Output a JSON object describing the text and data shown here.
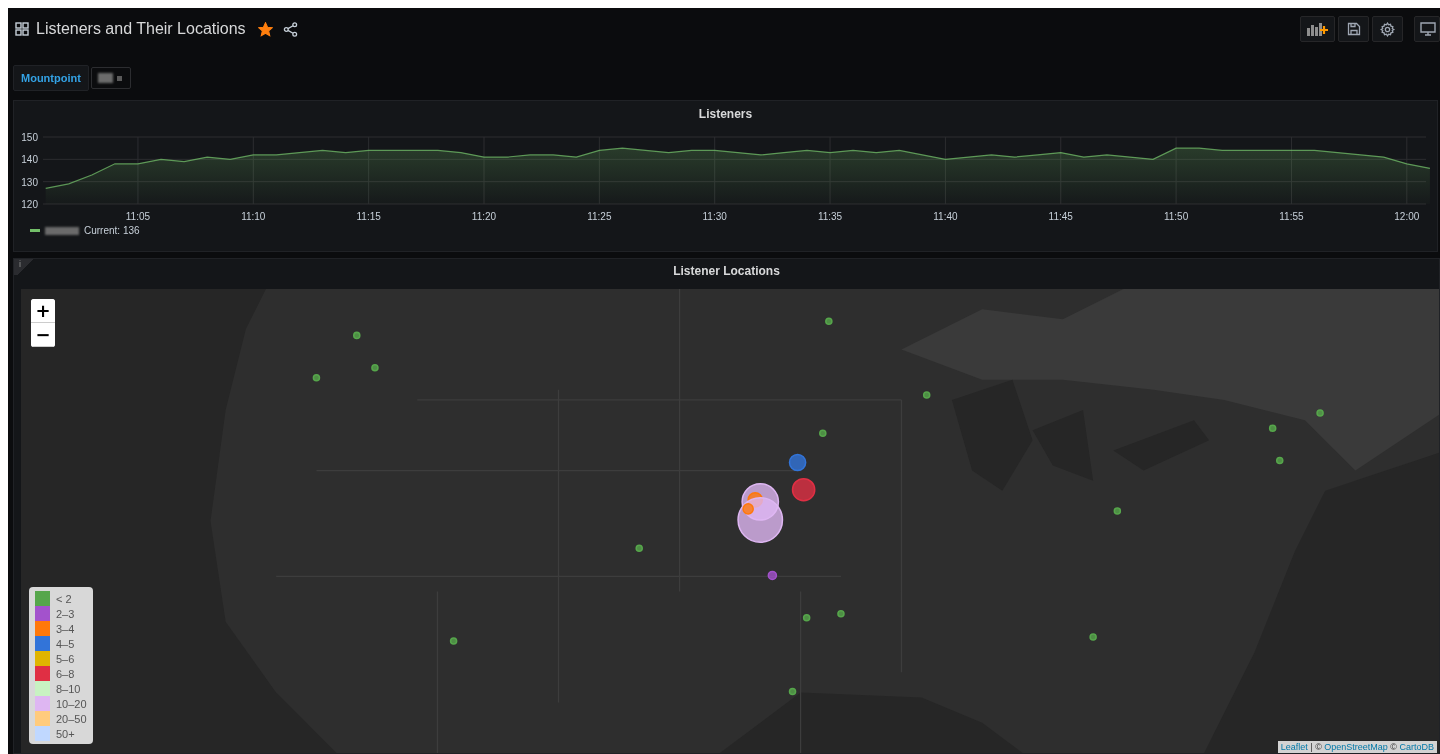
{
  "header": {
    "title": "Listeners and Their Locations",
    "starred": true
  },
  "variables": [
    {
      "label": "Mountpoint"
    }
  ],
  "graph_panel": {
    "title": "Listeners",
    "legend": {
      "current": "Current: 136"
    },
    "chart_data": {
      "type": "area",
      "categories": [
        null,
        null,
        null,
        null,
        "11:05",
        null,
        null,
        null,
        null,
        "11:10",
        null,
        null,
        null,
        null,
        "11:15",
        null,
        null,
        null,
        null,
        "11:20",
        null,
        null,
        null,
        null,
        "11:25",
        null,
        null,
        null,
        null,
        "11:30",
        null,
        null,
        null,
        null,
        "11:35",
        null,
        null,
        null,
        null,
        "11:40",
        null,
        null,
        null,
        null,
        "11:45",
        null,
        null,
        null,
        null,
        "11:50",
        null,
        null,
        null,
        null,
        "11:55",
        null,
        null,
        null,
        null,
        "12:00",
        null
      ],
      "series": [
        {
          "color": "#73bf69",
          "values": [
            127,
            129,
            133,
            138,
            138,
            140,
            139,
            141,
            140,
            142,
            142,
            143,
            144,
            143,
            144,
            144,
            144,
            144,
            143,
            141,
            141,
            142,
            142,
            141,
            144,
            145,
            144,
            143,
            144,
            144,
            143,
            142,
            143,
            144,
            143,
            144,
            143,
            144,
            142,
            140,
            141,
            142,
            141,
            142,
            143,
            141,
            142,
            141,
            140,
            145,
            145,
            144,
            144,
            144,
            144,
            144,
            143,
            142,
            141,
            138,
            136
          ]
        }
      ],
      "ylim": [
        120,
        150
      ],
      "grid": true,
      "yticks": [
        120,
        130,
        140,
        150
      ]
    }
  },
  "map_panel": {
    "title": "Listener Locations",
    "info": "i",
    "zoom_in": "+",
    "zoom_out": "−",
    "legend": [
      {
        "label": "< 2",
        "color": "#56a64b"
      },
      {
        "label": "2–3",
        "color": "#a352cc"
      },
      {
        "label": "3–4",
        "color": "#ff780a"
      },
      {
        "label": "4–5",
        "color": "#3274d9"
      },
      {
        "label": "5–6",
        "color": "#e0b400"
      },
      {
        "label": "6–8",
        "color": "#e02f44"
      },
      {
        "label": "8–10",
        "color": "#c8f2c2"
      },
      {
        "label": "10–20",
        "color": "#deb6f2"
      },
      {
        "label": "20–50",
        "color": "#ffcb7d"
      },
      {
        "label": "50+",
        "color": "#c0d8ff"
      }
    ],
    "attribution": [
      {
        "text": "Leaflet",
        "kind": "link"
      },
      {
        "text": " | © ",
        "kind": "text"
      },
      {
        "text": "OpenStreetMap",
        "kind": "link"
      },
      {
        "text": " © ",
        "kind": "text"
      },
      {
        "text": "CartoDB",
        "kind": "link"
      }
    ]
  }
}
